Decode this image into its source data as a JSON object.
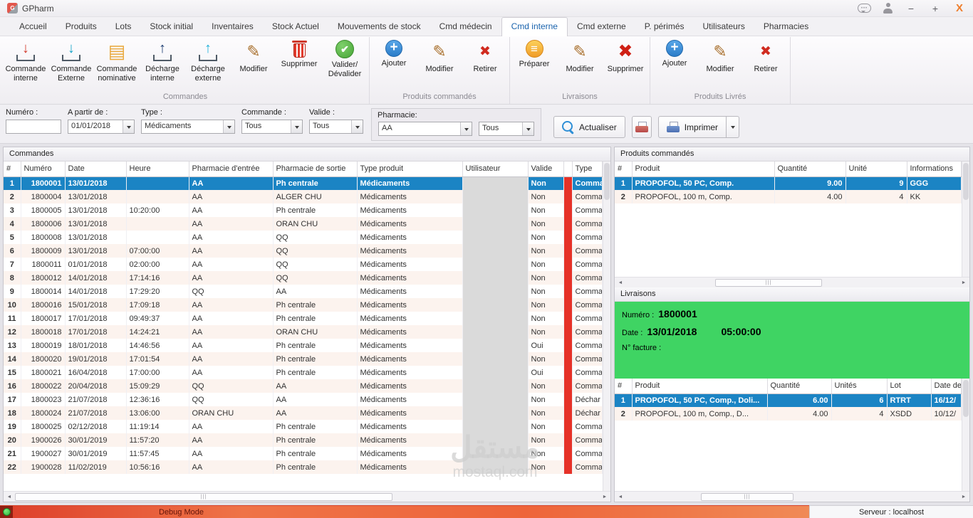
{
  "window": {
    "title": "GPharm",
    "minimize": "−",
    "maximize": "+",
    "close": "X"
  },
  "colors": {
    "selection_blue": "#1b84c4",
    "status_stripe_red": "#e63228",
    "delivery_green": "#3fd463",
    "active_tab_blue": "#1a63ad",
    "statusbar_red": "#dd3f2b"
  },
  "tabs": [
    {
      "label": "Accueil",
      "name": "tab-accueil"
    },
    {
      "label": "Produits",
      "name": "tab-produits"
    },
    {
      "label": "Lots",
      "name": "tab-lots"
    },
    {
      "label": "Stock initial",
      "name": "tab-stock-initial"
    },
    {
      "label": "Inventaires",
      "name": "tab-inventaires"
    },
    {
      "label": "Stock Actuel",
      "name": "tab-stock-actuel"
    },
    {
      "label": "Mouvements de stock",
      "name": "tab-mouvements-de-stock"
    },
    {
      "label": "Cmd médecin",
      "name": "tab-cmd-medecin"
    },
    {
      "label": "Cmd interne",
      "name": "tab-cmd-interne",
      "active": true
    },
    {
      "label": "Cmd externe",
      "name": "tab-cmd-externe"
    },
    {
      "label": "P. périmés",
      "name": "tab-p-perimes"
    },
    {
      "label": "Utilisateurs",
      "name": "tab-utilisateurs"
    },
    {
      "label": "Pharmacies",
      "name": "tab-pharmacies"
    }
  ],
  "ribbon": {
    "groups": [
      {
        "label": "Commandes",
        "buttons": [
          {
            "label": "Commande interne",
            "icon": "download-red-icon",
            "name": "ribbon-button-commande-interne"
          },
          {
            "label": "Commande Externe",
            "icon": "download-cyan-icon",
            "name": "ribbon-button-commande-externe"
          },
          {
            "label": "Commande nominative",
            "icon": "document-orange-icon",
            "name": "ribbon-button-commande-nominative"
          },
          {
            "label": "Décharge interne",
            "icon": "upload-navy-icon",
            "name": "ribbon-button-decharge-interne"
          },
          {
            "label": "Décharge externe",
            "icon": "upload-cyan-icon",
            "name": "ribbon-button-decharge-externe"
          },
          {
            "label": "Modifier",
            "icon": "pencil-icon",
            "name": "ribbon-button-modifier-commande"
          },
          {
            "label": "Supprimer",
            "icon": "trash-icon",
            "name": "ribbon-button-supprimer-commande"
          },
          {
            "label": "Valider/\nDévalider",
            "icon": "check-icon",
            "name": "ribbon-button-valider-devalider"
          }
        ]
      },
      {
        "label": "Produits commandés",
        "buttons": [
          {
            "label": "Ajouter",
            "icon": "add-icon",
            "name": "ribbon-button-ajouter-produit-commande"
          },
          {
            "label": "Modifier",
            "icon": "pencil-icon",
            "name": "ribbon-button-modifier-produit-commande"
          },
          {
            "label": "Retirer",
            "icon": "remove-red-icon",
            "name": "ribbon-button-retirer-produit-commande"
          }
        ]
      },
      {
        "label": "Livraisons",
        "buttons": [
          {
            "label": "Préparer",
            "icon": "prepare-orange-icon",
            "name": "ribbon-button-preparer-livraison"
          },
          {
            "label": "Modifier",
            "icon": "pencil-icon",
            "name": "ribbon-button-modifier-livraison"
          },
          {
            "label": "Supprimer",
            "icon": "delete-x-icon",
            "name": "ribbon-button-supprimer-livraison"
          }
        ]
      },
      {
        "label": "Produits Livrés",
        "buttons": [
          {
            "label": "Ajouter",
            "icon": "add-icon",
            "name": "ribbon-button-ajouter-produit-livre"
          },
          {
            "label": "Modifier",
            "icon": "pencil-icon",
            "name": "ribbon-button-modifier-produit-livre"
          },
          {
            "label": "Retirer",
            "icon": "remove-red-icon",
            "name": "ribbon-button-retirer-produit-livre"
          }
        ]
      }
    ]
  },
  "filters": {
    "numero_label": "Numéro :",
    "numero_value": "",
    "from_label": "A partir de :",
    "from_value": "01/01/2018",
    "type_label": "Type :",
    "type_value": "Médicaments",
    "commande_label": "Commande :",
    "commande_value": "Tous",
    "valide_label": "Valide :",
    "valide_value": "Tous",
    "pharmacie_label": "Pharmacie:",
    "pharmacie_value": "AA",
    "pharmacie_filter_value": "Tous",
    "refresh_label": "Actualiser",
    "print_label": "Imprimer"
  },
  "commands_panel": {
    "title": "Commandes",
    "columns": [
      "#",
      "Numéro",
      "Date",
      "Heure",
      "Pharmacie d'entrée",
      "Pharmacie de sortie",
      "Type produit",
      "Utilisateur",
      "Valide",
      "",
      "Type"
    ],
    "rows": [
      {
        "n": "1",
        "numero": "1800001",
        "date": "13/01/2018",
        "heure": "",
        "entree": "AA",
        "sortie": "Ph centrale",
        "produit": "Médicaments",
        "user": "",
        "valide": "Non",
        "type": "Comma",
        "selected": true
      },
      {
        "n": "2",
        "numero": "1800004",
        "date": "13/01/2018",
        "heure": "",
        "entree": "AA",
        "sortie": "ALGER CHU",
        "produit": "Médicaments",
        "user": "",
        "valide": "Non",
        "type": "Comma"
      },
      {
        "n": "3",
        "numero": "1800005",
        "date": "13/01/2018",
        "heure": "10:20:00",
        "entree": "AA",
        "sortie": "Ph centrale",
        "produit": "Médicaments",
        "user": "",
        "valide": "Non",
        "type": "Comma"
      },
      {
        "n": "4",
        "numero": "1800006",
        "date": "13/01/2018",
        "heure": "",
        "entree": "AA",
        "sortie": "ORAN CHU",
        "produit": "Médicaments",
        "user": "",
        "valide": "Non",
        "type": "Comma"
      },
      {
        "n": "5",
        "numero": "1800008",
        "date": "13/01/2018",
        "heure": "",
        "entree": "AA",
        "sortie": "QQ",
        "produit": "Médicaments",
        "user": "",
        "valide": "Non",
        "type": "Comma"
      },
      {
        "n": "6",
        "numero": "1800009",
        "date": "13/01/2018",
        "heure": "07:00:00",
        "entree": "AA",
        "sortie": "QQ",
        "produit": "Médicaments",
        "user": "",
        "valide": "Non",
        "type": "Comma"
      },
      {
        "n": "7",
        "numero": "1800011",
        "date": "01/01/2018",
        "heure": "02:00:00",
        "entree": "AA",
        "sortie": "QQ",
        "produit": "Médicaments",
        "user": "",
        "valide": "Non",
        "type": "Comma"
      },
      {
        "n": "8",
        "numero": "1800012",
        "date": "14/01/2018",
        "heure": "17:14:16",
        "entree": "AA",
        "sortie": "QQ",
        "produit": "Médicaments",
        "user": "",
        "valide": "Non",
        "type": "Comma"
      },
      {
        "n": "9",
        "numero": "1800014",
        "date": "14/01/2018",
        "heure": "17:29:20",
        "entree": "QQ",
        "sortie": "AA",
        "produit": "Médicaments",
        "user": "",
        "valide": "Non",
        "type": "Comma"
      },
      {
        "n": "10",
        "numero": "1800016",
        "date": "15/01/2018",
        "heure": "17:09:18",
        "entree": "AA",
        "sortie": "Ph centrale",
        "produit": "Médicaments",
        "user": "",
        "valide": "Non",
        "type": "Comma"
      },
      {
        "n": "11",
        "numero": "1800017",
        "date": "17/01/2018",
        "heure": "09:49:37",
        "entree": "AA",
        "sortie": "Ph centrale",
        "produit": "Médicaments",
        "user": "",
        "valide": "Non",
        "type": "Comma"
      },
      {
        "n": "12",
        "numero": "1800018",
        "date": "17/01/2018",
        "heure": "14:24:21",
        "entree": "AA",
        "sortie": "ORAN CHU",
        "produit": "Médicaments",
        "user": "",
        "valide": "Non",
        "type": "Comma"
      },
      {
        "n": "13",
        "numero": "1800019",
        "date": "18/01/2018",
        "heure": "14:46:56",
        "entree": "AA",
        "sortie": "Ph centrale",
        "produit": "Médicaments",
        "user": "",
        "valide": "Oui",
        "type": "Comma"
      },
      {
        "n": "14",
        "numero": "1800020",
        "date": "19/01/2018",
        "heure": "17:01:54",
        "entree": "AA",
        "sortie": "Ph centrale",
        "produit": "Médicaments",
        "user": "",
        "valide": "Non",
        "type": "Comma"
      },
      {
        "n": "15",
        "numero": "1800021",
        "date": "16/04/2018",
        "heure": "17:00:00",
        "entree": "AA",
        "sortie": "Ph centrale",
        "produit": "Médicaments",
        "user": "",
        "valide": "Oui",
        "type": "Comma"
      },
      {
        "n": "16",
        "numero": "1800022",
        "date": "20/04/2018",
        "heure": "15:09:29",
        "entree": "QQ",
        "sortie": "AA",
        "produit": "Médicaments",
        "user": "",
        "valide": "Non",
        "type": "Comma"
      },
      {
        "n": "17",
        "numero": "1800023",
        "date": "21/07/2018",
        "heure": "12:36:16",
        "entree": "QQ",
        "sortie": "AA",
        "produit": "Médicaments",
        "user": "",
        "valide": "Non",
        "type": "Déchar"
      },
      {
        "n": "18",
        "numero": "1800024",
        "date": "21/07/2018",
        "heure": "13:06:00",
        "entree": "ORAN CHU",
        "sortie": "AA",
        "produit": "Médicaments",
        "user": "",
        "valide": "Non",
        "type": "Déchar"
      },
      {
        "n": "19",
        "numero": "1800025",
        "date": "02/12/2018",
        "heure": "11:19:14",
        "entree": "AA",
        "sortie": "Ph centrale",
        "produit": "Médicaments",
        "user": "",
        "valide": "Non",
        "type": "Comma"
      },
      {
        "n": "20",
        "numero": "1900026",
        "date": "30/01/2019",
        "heure": "11:57:20",
        "entree": "AA",
        "sortie": "Ph centrale",
        "produit": "Médicaments",
        "user": "",
        "valide": "Non",
        "type": "Comma"
      },
      {
        "n": "21",
        "numero": "1900027",
        "date": "30/01/2019",
        "heure": "11:57:45",
        "entree": "AA",
        "sortie": "Ph centrale",
        "produit": "Médicaments",
        "user": "",
        "valide": "Non",
        "type": "Comma"
      },
      {
        "n": "22",
        "numero": "1900028",
        "date": "11/02/2019",
        "heure": "10:56:16",
        "entree": "AA",
        "sortie": "Ph centrale",
        "produit": "Médicaments",
        "user": "",
        "valide": "Non",
        "type": "Comma"
      }
    ]
  },
  "ordered_products_panel": {
    "title": "Produits commandés",
    "columns": [
      "#",
      "Produit",
      "Quantité",
      "Unité",
      "Informations"
    ],
    "rows": [
      {
        "n": "1",
        "produit": "PROPOFOL, 50 PC, Comp.",
        "quantite": "9.00",
        "unite": "9",
        "informations": "GGG",
        "selected": true
      },
      {
        "n": "2",
        "produit": "PROPOFOL, 100 m, Comp.",
        "quantite": "4.00",
        "unite": "4",
        "informations": "KK"
      }
    ]
  },
  "deliveries_panel": {
    "title": "Livraisons",
    "numero_label": "Numéro :",
    "numero": "1800001",
    "date_label": "Date :",
    "date": "13/01/2018",
    "time": "05:00:00",
    "facture_label": "N° facture :",
    "columns": [
      "#",
      "Produit",
      "Quantité",
      "Unités",
      "Lot",
      "Date de"
    ],
    "rows": [
      {
        "n": "1",
        "produit": "PROPOFOL, 50 PC, Comp., Doli...",
        "quantite": "6.00",
        "unites": "6",
        "lot": "RTRT",
        "date": "16/12/",
        "selected": true
      },
      {
        "n": "2",
        "produit": "PROPOFOL, 100 m, Comp., D...",
        "quantite": "4.00",
        "unites": "4",
        "lot": "XSDD",
        "date": "10/12/"
      }
    ]
  },
  "statusbar": {
    "debug_label": "Debug Mode",
    "server_label": "Serveur : localhost"
  },
  "watermark": {
    "line1": "مستقل",
    "line2": "mostaql.com"
  }
}
